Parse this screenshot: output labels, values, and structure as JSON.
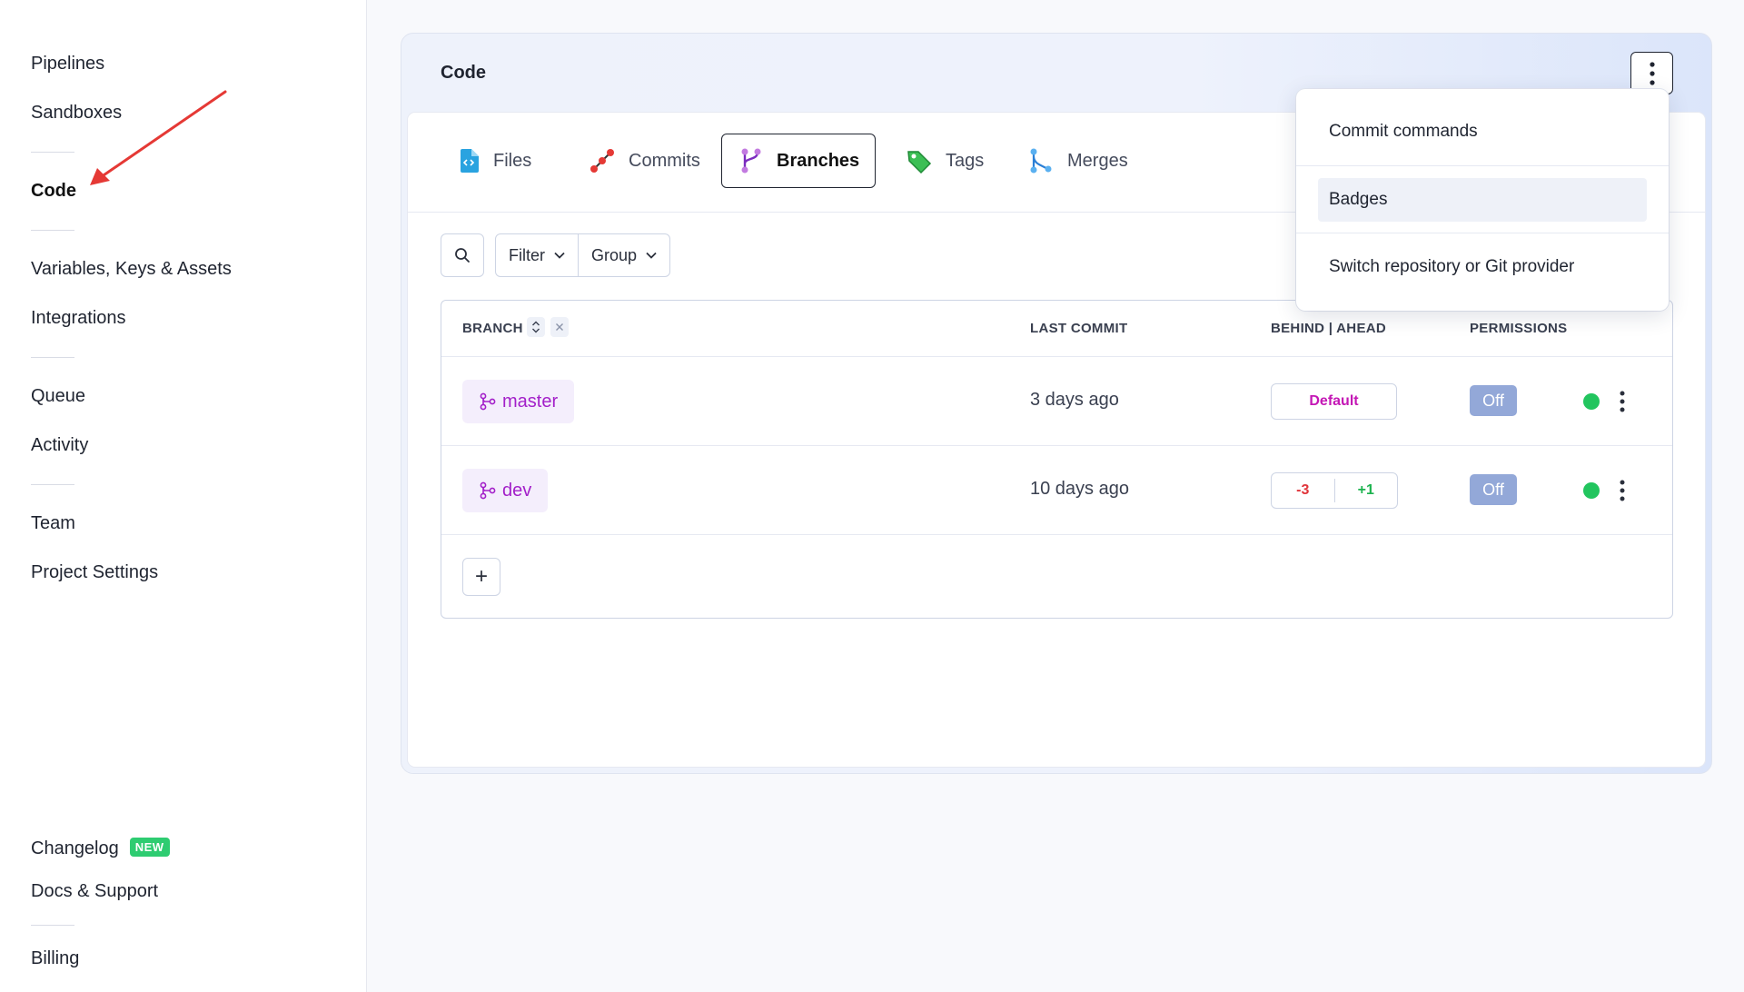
{
  "sidebar": {
    "items": [
      {
        "label": "Pipelines"
      },
      {
        "label": "Sandboxes"
      },
      {
        "label": "Code"
      },
      {
        "label": "Variables, Keys & Assets"
      },
      {
        "label": "Integrations"
      },
      {
        "label": "Queue"
      },
      {
        "label": "Activity"
      },
      {
        "label": "Team"
      },
      {
        "label": "Project Settings"
      },
      {
        "label": "Changelog",
        "badge": "NEW"
      },
      {
        "label": "Docs & Support"
      },
      {
        "label": "Billing"
      }
    ],
    "active": "Code"
  },
  "panel": {
    "title": "Code",
    "tabs": [
      {
        "label": "Files",
        "icon": "file-code-icon"
      },
      {
        "label": "Commits",
        "icon": "commit-icon"
      },
      {
        "label": "Branches",
        "icon": "branch-icon"
      },
      {
        "label": "Tags",
        "icon": "tag-icon"
      },
      {
        "label": "Merges",
        "icon": "merge-icon"
      }
    ],
    "active_tab": "Branches"
  },
  "toolbar": {
    "filter_label": "Filter",
    "group_label": "Group"
  },
  "table": {
    "headers": {
      "branch": "BRANCH",
      "last_commit": "LAST COMMIT",
      "behind_ahead": "BEHIND | AHEAD",
      "permissions": "PERMISSIONS"
    },
    "rows": [
      {
        "branch": "master",
        "last_commit": "3 days ago",
        "status": "Default",
        "permissions": "Off"
      },
      {
        "branch": "dev",
        "last_commit": "10 days ago",
        "behind": "-3",
        "ahead": "+1",
        "permissions": "Off"
      }
    ],
    "add_label": "+"
  },
  "menu": {
    "items": [
      {
        "label": "Commit commands"
      },
      {
        "label": "Badges"
      },
      {
        "label": "Switch repository or Git provider"
      }
    ]
  },
  "colors": {
    "accent": "#1f2430",
    "branch": "#a320c9",
    "behind": "#e0343a",
    "ahead": "#1db34f",
    "status_ok": "#22c55e",
    "annotation_arrow": "#e53935"
  }
}
